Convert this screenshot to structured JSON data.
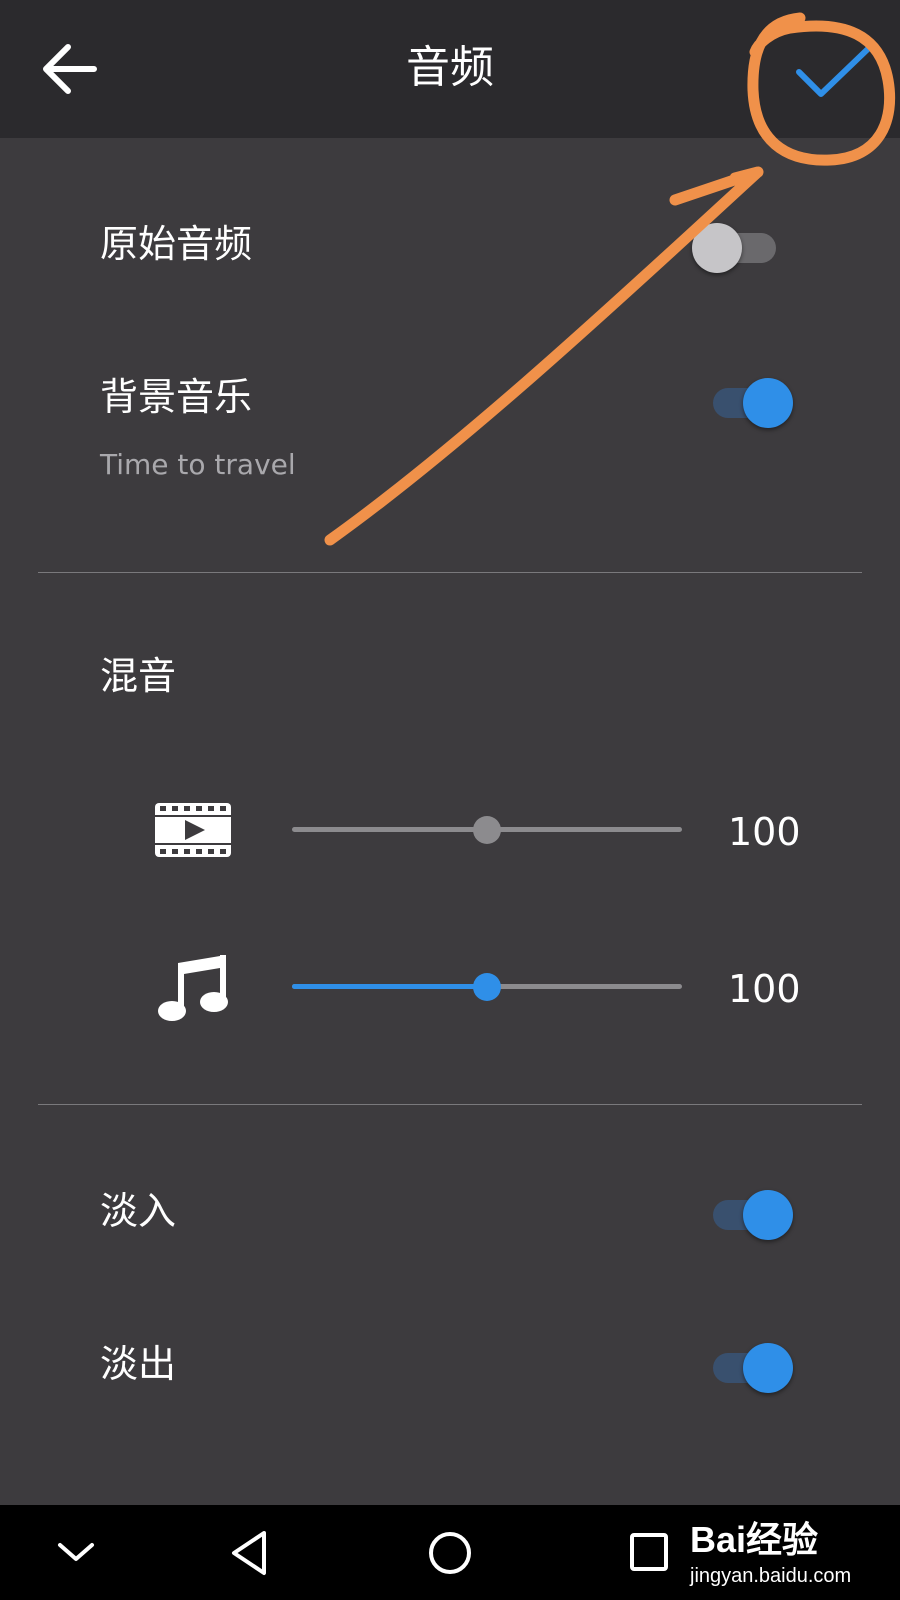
{
  "header": {
    "title": "音频",
    "back_icon": "arrow-left-icon",
    "confirm_icon": "checkmark-icon",
    "confirm_color": "#2f8fe8"
  },
  "audio": {
    "original_audio": {
      "label": "原始音频",
      "enabled": false
    },
    "background_music": {
      "label": "背景音乐",
      "track": "Time to travel",
      "enabled": true
    }
  },
  "mix": {
    "label": "混音",
    "video_volume": {
      "icon": "film-icon",
      "value": "100",
      "level": 0.5
    },
    "music_volume": {
      "icon": "music-note-icon",
      "value": "100",
      "level": 0.5
    }
  },
  "fade": {
    "fade_in": {
      "label": "淡入",
      "enabled": true
    },
    "fade_out": {
      "label": "淡出",
      "enabled": true
    }
  },
  "nav": {
    "items": [
      "chevron-down-icon",
      "back-triangle-icon",
      "home-circle-icon",
      "recents-square-icon"
    ]
  },
  "watermark": {
    "logo": "Bai经验",
    "url": "jingyan.baidu.com"
  },
  "colors": {
    "accent": "#2f8fe8",
    "annotation": "#f0914a",
    "background": "#3d3b3e",
    "toolbar": "#2b2a2d"
  }
}
